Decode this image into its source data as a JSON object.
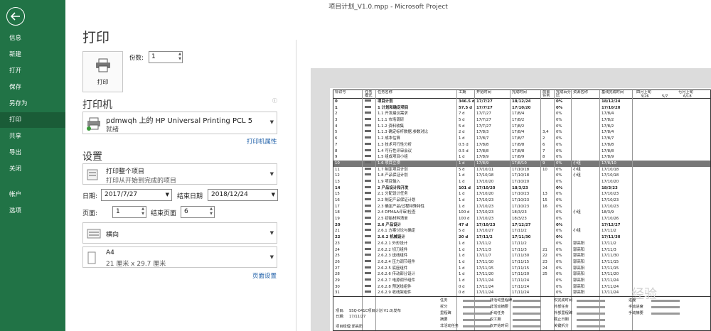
{
  "titlebar": {
    "title": "项目计划_V1.0.mpp - Microsoft Project"
  },
  "nav": {
    "items": [
      "信息",
      "新建",
      "打开",
      "保存",
      "另存为",
      "打印",
      "共享",
      "导出",
      "关闭",
      "帐户",
      "选项"
    ],
    "active": "打印"
  },
  "page": {
    "title": "打印"
  },
  "print": {
    "button_label": "打印",
    "copies_label": "份数:",
    "copies_value": "1"
  },
  "printer": {
    "section": "打印机",
    "name": "pdmwqh 上的 HP Universal Printing PCL 5",
    "status": "就绪",
    "properties_link": "打印机属性"
  },
  "settings": {
    "section": "设置",
    "scope_title": "打印整个项目",
    "scope_sub": "打印从开始到完成的项目",
    "date_label": "日期:",
    "date_value": "2017/7/27",
    "end_label": "结束日期",
    "end_value": "2018/12/24",
    "page_label": "页面:",
    "page_value": "1",
    "endpage_label": "结束页面",
    "endpage_value": "6",
    "orientation": "横向",
    "paper_title": "A4",
    "paper_sub": "21 厘米 x 29.7 厘米",
    "page_setup_link": "页面设置"
  },
  "preview": {
    "headers": [
      "标识号",
      "任务模式",
      "任务名称",
      "工期",
      "开始时间",
      "完成时间",
      "前置任务",
      "完成百分比",
      "资源名称",
      "基线完成时间"
    ],
    "timeline": [
      "四月上旬",
      "七月上旬",
      "3/26",
      "5/7",
      "6/18"
    ],
    "rows": [
      [
        "0",
        "",
        "项目计划",
        "346.5 d",
        "17/7/27",
        "18/12/24",
        "",
        "0%",
        "",
        "18/12/24"
      ],
      [
        "1",
        "",
        "1 计划和确定项目",
        "57.5 d",
        "17/7/27",
        "17/10/20",
        "",
        "0%",
        "",
        "17/10/20"
      ],
      [
        "2",
        "",
        "1.1 开发建议需求",
        "7 d",
        "17/7/27",
        "17/8/4",
        "",
        "0%",
        "",
        "17/8/4"
      ],
      [
        "3",
        "",
        "1.1.1 市场调研",
        "5 d",
        "17/7/27",
        "17/8/2",
        "",
        "0%",
        "",
        "17/8/2"
      ],
      [
        "4",
        "",
        "1.1.2 资料收集",
        "5 d",
        "17/7/27",
        "17/8/2",
        "",
        "0%",
        "",
        "17/8/2"
      ],
      [
        "5",
        "",
        "1.1.3 确定标杆数据,参数对比",
        "2 d",
        "17/8/3",
        "17/8/4",
        "3,4",
        "0%",
        "",
        "17/8/4"
      ],
      [
        "6",
        "",
        "1.2 成本估算",
        "1 d",
        "17/8/7",
        "17/8/7",
        "2",
        "0%",
        "",
        "17/8/7"
      ],
      [
        "7",
        "",
        "1.3 技术可行性分析",
        "0.5 d",
        "17/8/8",
        "17/8/8",
        "6",
        "0%",
        "",
        "17/8/8"
      ],
      [
        "8",
        "",
        "1.4 可行性评审会议",
        "0.5 d",
        "17/8/8",
        "17/8/8",
        "7",
        "0%",
        "",
        "17/8/8"
      ],
      [
        "9",
        "",
        "1.5 组成项目小组",
        "1 d",
        "17/8/9",
        "17/8/9",
        "8",
        "0%",
        "",
        "17/8/9"
      ],
      [
        "10",
        "",
        "1.6 项目立项",
        "1 d",
        "17/8/9",
        "17/8/10",
        "9",
        "0%",
        "小组",
        "17/8/10"
      ],
      [
        "11",
        "",
        "1.7 制定项目计划",
        "5 d",
        "17/10/11",
        "17/10/18",
        "10",
        "0%",
        "小组",
        "17/10/18"
      ],
      [
        "12",
        "",
        "1.8 产品保证计划",
        "1 d",
        "17/10/18",
        "17/10/18",
        "",
        "0%",
        "小组",
        "17/10/18"
      ],
      [
        "13",
        "",
        "1.9 项目输入",
        "1 d",
        "17/10/20",
        "17/10/20",
        "",
        "0%",
        "",
        "17/10/20"
      ],
      [
        "14",
        "",
        "2 产品设计和开发",
        "101 d",
        "17/10/20",
        "18/3/23",
        "",
        "0%",
        "",
        "18/3/23"
      ],
      [
        "15",
        "",
        "2.1 分配设计任务",
        "1 d",
        "17/10/20",
        "17/10/23",
        "13",
        "0%",
        "",
        "17/10/23"
      ],
      [
        "16",
        "",
        "2.2 制定产品保证计划",
        "1 d",
        "17/10/23",
        "17/10/23",
        "15",
        "0%",
        "",
        "17/10/23"
      ],
      [
        "17",
        "",
        "2.3 确定产品/过程特殊特性",
        "1 d",
        "17/10/23",
        "17/10/23",
        "16",
        "0%",
        "",
        "17/10/23"
      ],
      [
        "18",
        "",
        "2.4 DFM&A评审/检查",
        "100 d",
        "17/10/23",
        "18/3/23",
        "",
        "0%",
        "小组",
        "18/3/9"
      ],
      [
        "19",
        "",
        "2.5 初始材料清单",
        "100 d",
        "17/10/23",
        "18/3/23",
        "",
        "0%",
        "",
        "17/10/26"
      ],
      [
        "20",
        "",
        "2.6 产品设计",
        "47 d",
        "17/10/23",
        "17/12/27",
        "",
        "0%",
        "",
        "17/12/27"
      ],
      [
        "21",
        "",
        "2.6.1 方案讨论与确定",
        "5 d",
        "17/10/27",
        "17/11/2",
        "",
        "0%",
        "小组",
        "17/11/2"
      ],
      [
        "22",
        "",
        "2.6.2 机械设计",
        "20 d",
        "17/11/2",
        "17/11/30",
        "",
        "0%",
        "",
        "17/11/30"
      ],
      [
        "23",
        "",
        "2.6.2.1 外形设计",
        "1 d",
        "17/11/2",
        "17/11/2",
        "",
        "0%",
        "郭高阳",
        "17/11/2"
      ],
      [
        "24",
        "",
        "2.6.2.2 切刀组件",
        "1 d",
        "17/11/3",
        "17/11/3",
        "21",
        "0%",
        "郭高阳",
        "17/11/3"
      ],
      [
        "25",
        "",
        "2.6.2.3 送线组件",
        "1 d",
        "17/11/7",
        "17/11/30",
        "22",
        "0%",
        "郭高阳",
        "17/11/30"
      ],
      [
        "26",
        "",
        "2.6.2.4 压力调节组件",
        "1 d",
        "17/11/10",
        "17/11/15",
        "23",
        "0%",
        "郭高阳",
        "17/11/15"
      ],
      [
        "27",
        "",
        "2.6.2.5 底座组件",
        "1 d",
        "17/11/15",
        "17/11/15",
        "24",
        "0%",
        "郭高阳",
        "17/11/15"
      ],
      [
        "28",
        "",
        "2.6.2.6 传动部分设计",
        "1 d",
        "17/11/20",
        "17/11/20",
        "25",
        "0%",
        "郭高阳",
        "17/11/20"
      ],
      [
        "29",
        "",
        "2.6.2.7 电源调节组件",
        "1 d",
        "17/11/24",
        "17/11/24",
        "",
        "0%",
        "郭高阳",
        "17/11/24"
      ],
      [
        "30",
        "",
        "2.6.2.8 预送线组件",
        "0 d",
        "17/11/24",
        "17/11/24",
        "",
        "0%",
        "郭高阳",
        "17/11/24"
      ],
      [
        "31",
        "",
        "2.6.2.9 收线架组件",
        "0 d",
        "17/11/24",
        "17/11/24",
        "",
        "0%",
        "郭高阳",
        "17/11/24"
      ]
    ],
    "legend": {
      "project_label": "项目:",
      "project_value": "SSQ-041C项目计划 V1.0(发布",
      "date_label": "日期:",
      "date_value": "17/11/27",
      "footer": "项目经理:郭高阳",
      "items": [
        "任务",
        "拆分",
        "里程碑",
        "摘要",
        "非活动任务",
        "非活动里程碑",
        "非活动摘要",
        "手动任务",
        "仅工期",
        "仅开始时间",
        "仅完成时间",
        "外部任务",
        "外部里程碑",
        "截止日期",
        "关键拆分",
        "进度",
        "手动进度",
        "手动摘要"
      ]
    }
  },
  "watermark": "经验"
}
